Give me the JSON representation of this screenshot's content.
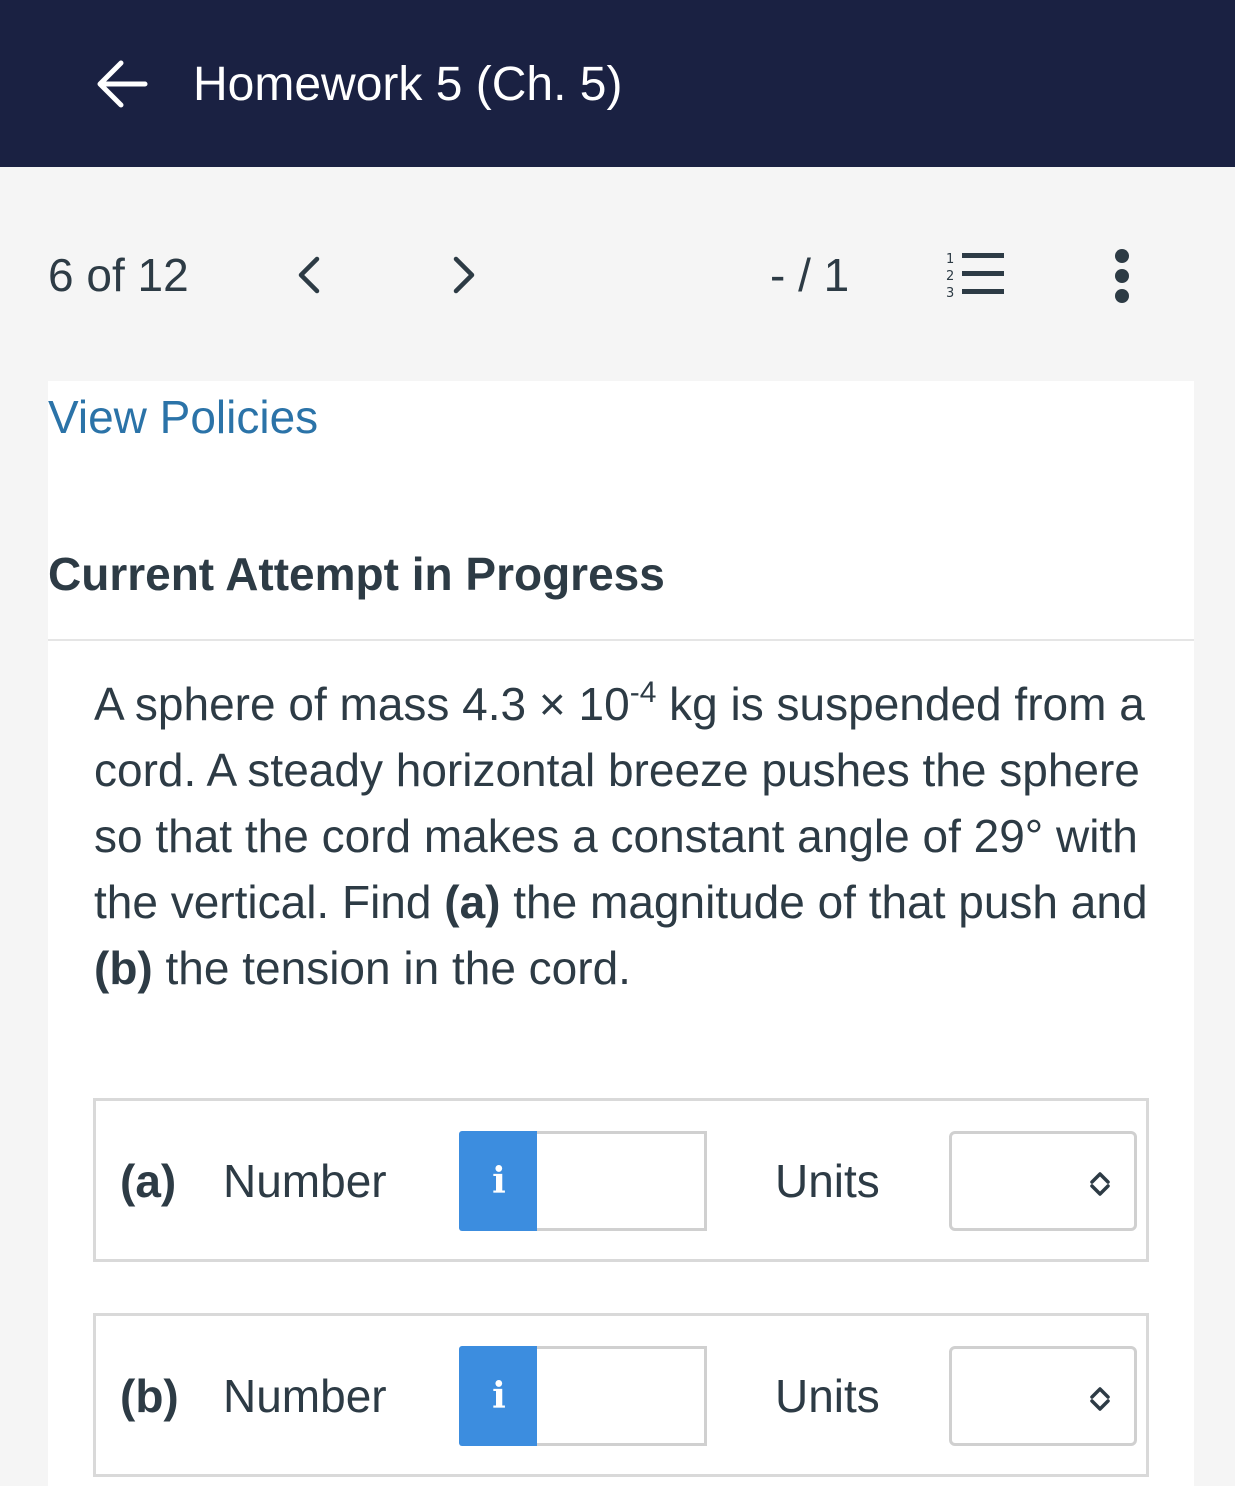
{
  "header": {
    "title": "Homework 5 (Ch. 5)",
    "back_icon": "arrow-left-icon"
  },
  "nav": {
    "page_count": "6 of 12",
    "score": "- / 1",
    "prev_icon": "chevron-left-icon",
    "next_icon": "chevron-right-icon",
    "list_icon": "numbered-list-icon",
    "more_icon": "more-vertical-icon"
  },
  "content": {
    "policies_link": "View Policies",
    "attempt_heading": "Current Attempt in Progress",
    "question": {
      "part1": "A sphere of mass 4.3 × 10",
      "exponent": "-4",
      "part2": " kg is suspended from a cord. A steady horizontal breeze pushes the sphere so that the cord makes a constant angle of 29° with the vertical. Find ",
      "bold_a": "(a)",
      "part3": " the magnitude of that push and ",
      "bold_b": "(b)",
      "part4": " the tension in the cord."
    }
  },
  "answers": [
    {
      "part": "(a)",
      "number_label": "Number",
      "info_label": "i",
      "number_value": "",
      "units_label": "Units",
      "units_value": ""
    },
    {
      "part": "(b)",
      "number_label": "Number",
      "info_label": "i",
      "number_value": "",
      "units_label": "Units",
      "units_value": ""
    }
  ],
  "colors": {
    "header_bg": "#1a2142",
    "link": "#2b73a8",
    "info_button": "#3c8ddf",
    "text": "#2d3b45"
  }
}
